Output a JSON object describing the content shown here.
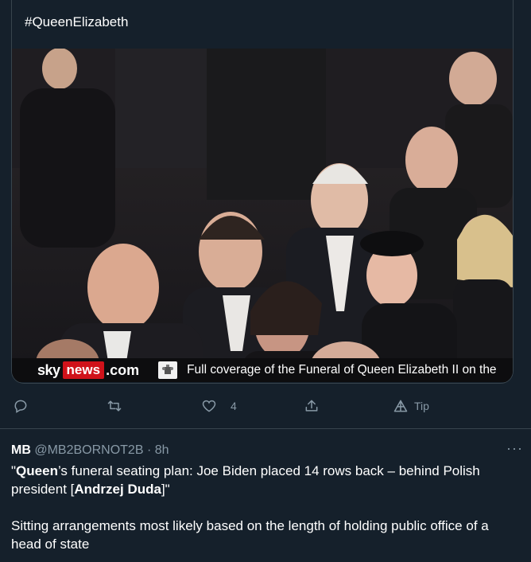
{
  "media_card": {
    "hashtag": "#QueenElizabeth",
    "ticker": {
      "brand_sky": "sky",
      "brand_news": "news",
      "brand_domain": ".com",
      "headline": "Full coverage of the Funeral of Queen Elizabeth II on the"
    }
  },
  "actions": {
    "reply_icon": "speech-bubble-icon",
    "retweet_icon": "retweet-icon",
    "like_icon": "heart-icon",
    "like_count": "4",
    "share_icon": "share-icon",
    "tip_icon": "tip-icon",
    "tip_label": "Tip"
  },
  "tweet": {
    "author_name": "MB",
    "author_handle": "@MB2BORNOT2B",
    "separator": "·",
    "time": "8h",
    "more_label": "···",
    "line1_quote_open": "\"",
    "line1_bold": "Queen",
    "line1_rest": "’s funeral seating plan: Joe Biden placed 14 rows back – behind Polish president [",
    "line1_bold2": "Andrzej Duda",
    "line1_close": "]\"",
    "paragraph2": "Sitting arrangements most likely based on the length of holding public office of a head of state"
  },
  "colors": {
    "background": "#15202b",
    "border": "#38444d",
    "muted": "#8899a6",
    "news_red": "#d0121a"
  }
}
